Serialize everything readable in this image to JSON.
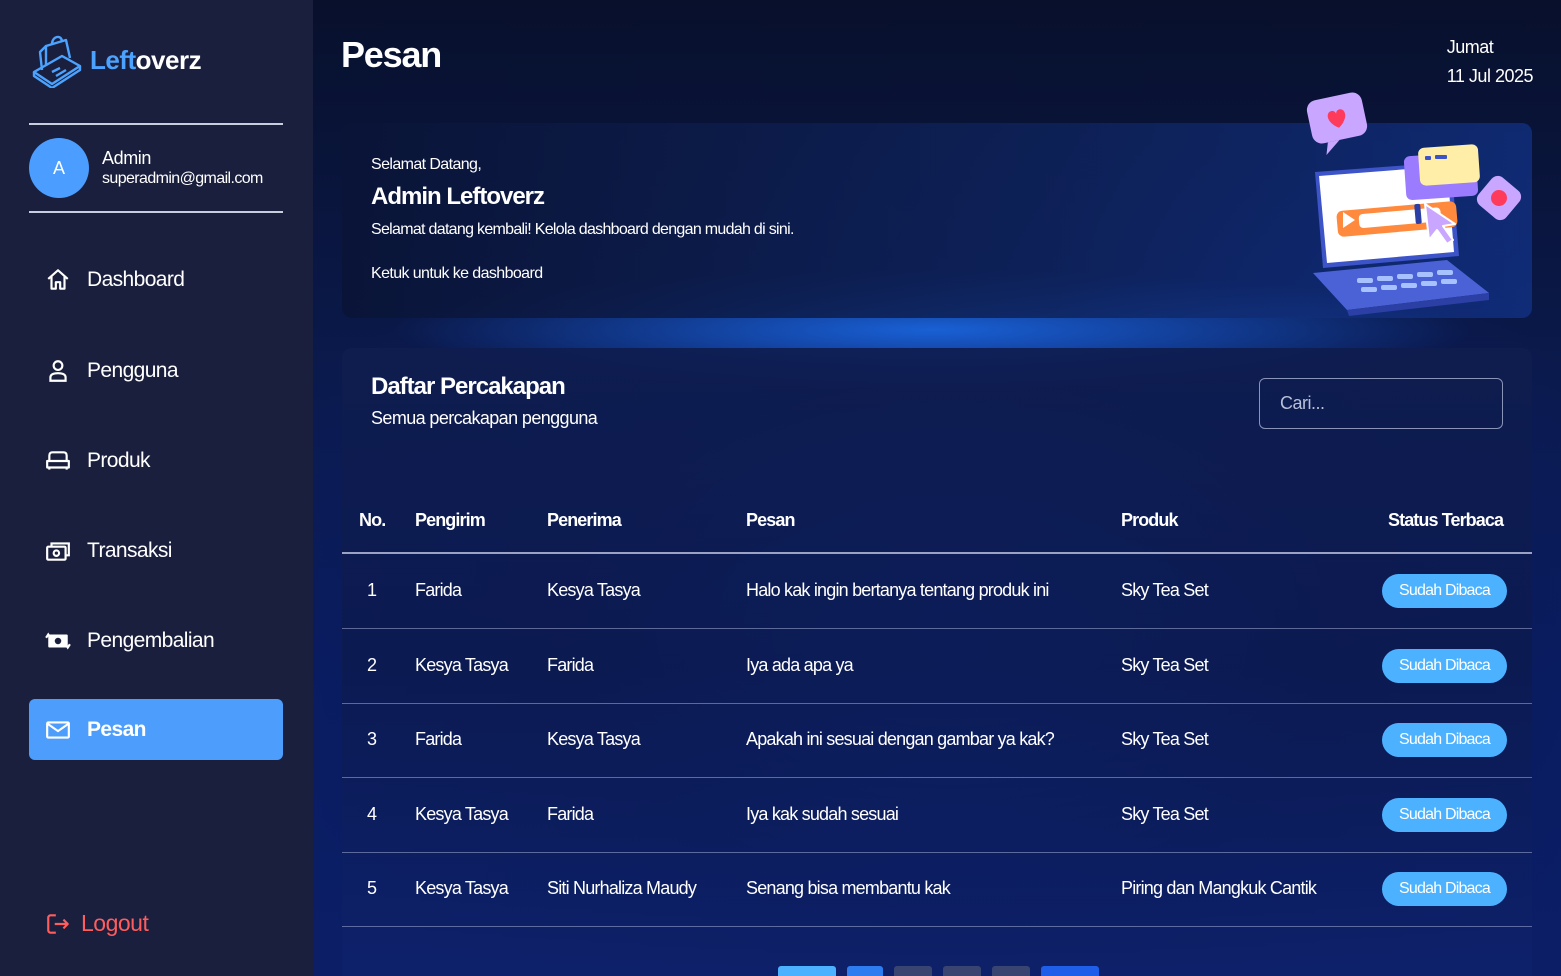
{
  "app": {
    "logo_part1": "Left",
    "logo_part2": "overz"
  },
  "user": {
    "initial": "A",
    "name": "Admin",
    "email": "superadmin@gmail.com"
  },
  "sidebar": {
    "items": [
      {
        "label": "Dashboard",
        "icon": "home-icon",
        "active": false
      },
      {
        "label": "Pengguna",
        "icon": "user-icon",
        "active": false
      },
      {
        "label": "Produk",
        "icon": "sofa-icon",
        "active": false
      },
      {
        "label": "Transaksi",
        "icon": "money-icon",
        "active": false
      },
      {
        "label": "Pengembalian",
        "icon": "refund-icon",
        "active": false
      },
      {
        "label": "Pesan",
        "icon": "mail-icon",
        "active": true
      }
    ],
    "logout_label": "Logout"
  },
  "header": {
    "title": "Pesan",
    "day": "Jumat",
    "date": "11 Jul 2025"
  },
  "welcome": {
    "greeting": "Selamat Datang,",
    "name": "Admin Leftoverz",
    "text": "Selamat datang kembali! Kelola dashboard dengan mudah di sini.",
    "link": "Ketuk untuk ke dashboard"
  },
  "conversations": {
    "title": "Daftar Percakapan",
    "subtitle": "Semua percakapan pengguna",
    "search_placeholder": "Cari...",
    "columns": [
      "No.",
      "Pengirim",
      "Penerima",
      "Pesan",
      "Produk",
      "Status Terbaca"
    ],
    "rows": [
      {
        "no": "1",
        "sender": "Farida",
        "receiver": "Kesya Tasya",
        "message": "Halo kak ingin bertanya tentang produk ini",
        "product": "Sky Tea Set",
        "status": "Sudah Dibaca"
      },
      {
        "no": "2",
        "sender": "Kesya Tasya",
        "receiver": "Farida",
        "message": "Iya ada apa ya",
        "product": "Sky Tea Set",
        "status": "Sudah Dibaca"
      },
      {
        "no": "3",
        "sender": "Farida",
        "receiver": "Kesya Tasya",
        "message": "Apakah ini sesuai dengan gambar ya kak?",
        "product": "Sky Tea Set",
        "status": "Sudah Dibaca"
      },
      {
        "no": "4",
        "sender": "Kesya Tasya",
        "receiver": "Farida",
        "message": "Iya kak sudah sesuai",
        "product": "Sky Tea Set",
        "status": "Sudah Dibaca"
      },
      {
        "no": "5",
        "sender": "Kesya Tasya",
        "receiver": "Siti Nurhaliza Maudy",
        "message": "Senang bisa membantu kak",
        "product": "Piring dan Mangkuk Cantik",
        "status": "Sudah Dibaca"
      }
    ]
  },
  "colors": {
    "accent": "#4d9dfc",
    "badge": "#4cb2ff",
    "logout": "#ff5d5d",
    "sidebar_bg": "#1a1f3d"
  }
}
